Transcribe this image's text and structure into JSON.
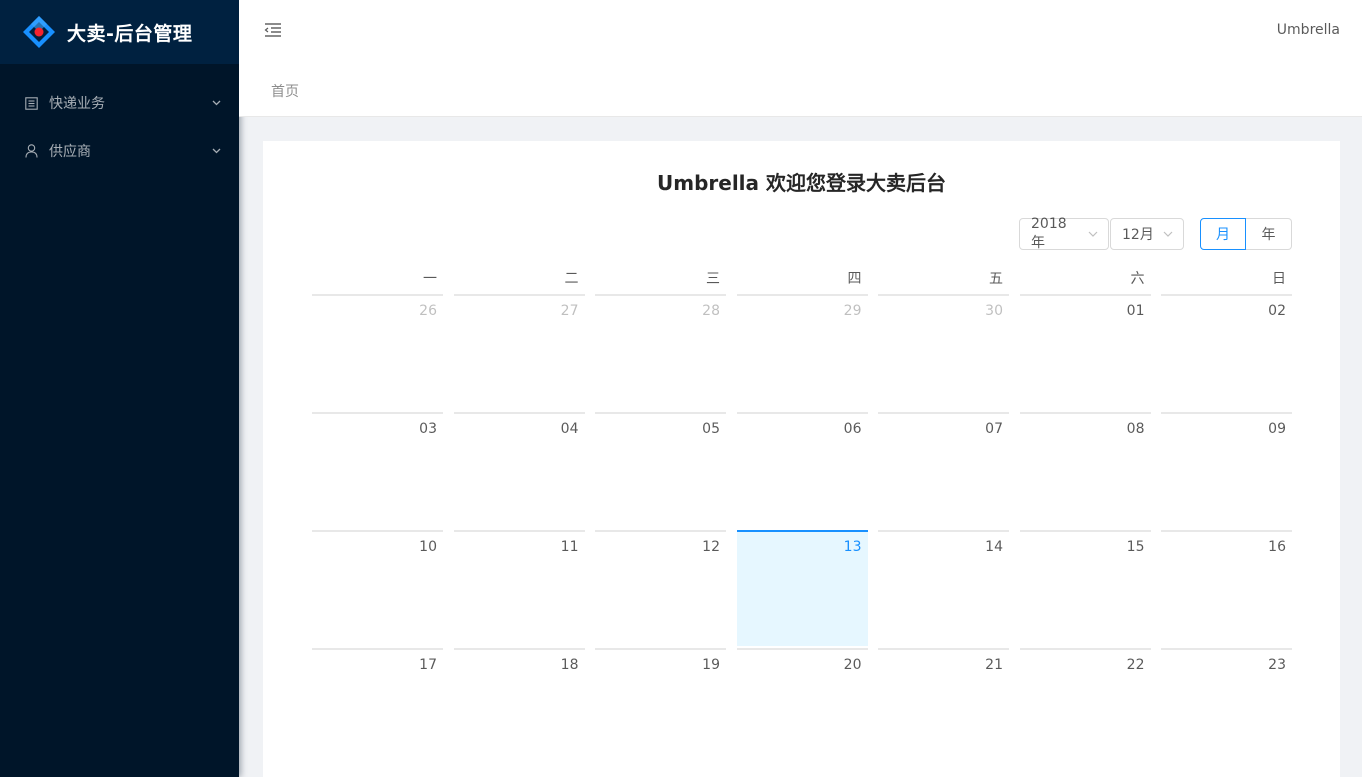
{
  "app": {
    "title": "大卖-后台管理"
  },
  "sidebar": {
    "items": [
      {
        "label": "快递业务",
        "icon": "profile-icon"
      },
      {
        "label": "供应商",
        "icon": "user-icon"
      }
    ]
  },
  "header": {
    "user_name": "Umbrella"
  },
  "breadcrumb": {
    "home": "首页"
  },
  "main": {
    "welcome": "Umbrella 欢迎您登录大卖后台",
    "calendar": {
      "year": "2018年",
      "month": "12月",
      "mode_month": "月",
      "mode_year": "年",
      "weekdays": [
        "一",
        "二",
        "三",
        "四",
        "五",
        "六",
        "日"
      ],
      "rows": [
        [
          "26",
          "27",
          "28",
          "29",
          "30",
          "01",
          "02"
        ],
        [
          "03",
          "04",
          "05",
          "06",
          "07",
          "08",
          "09"
        ],
        [
          "10",
          "11",
          "12",
          "13",
          "14",
          "15",
          "16"
        ],
        [
          "17",
          "18",
          "19",
          "20",
          "21",
          "22",
          "23"
        ]
      ]
    }
  },
  "colors": {
    "sidebar_bg": "#001529",
    "logo_bg": "#002140",
    "accent": "#1890ff",
    "today_bg": "#e6f7ff"
  }
}
